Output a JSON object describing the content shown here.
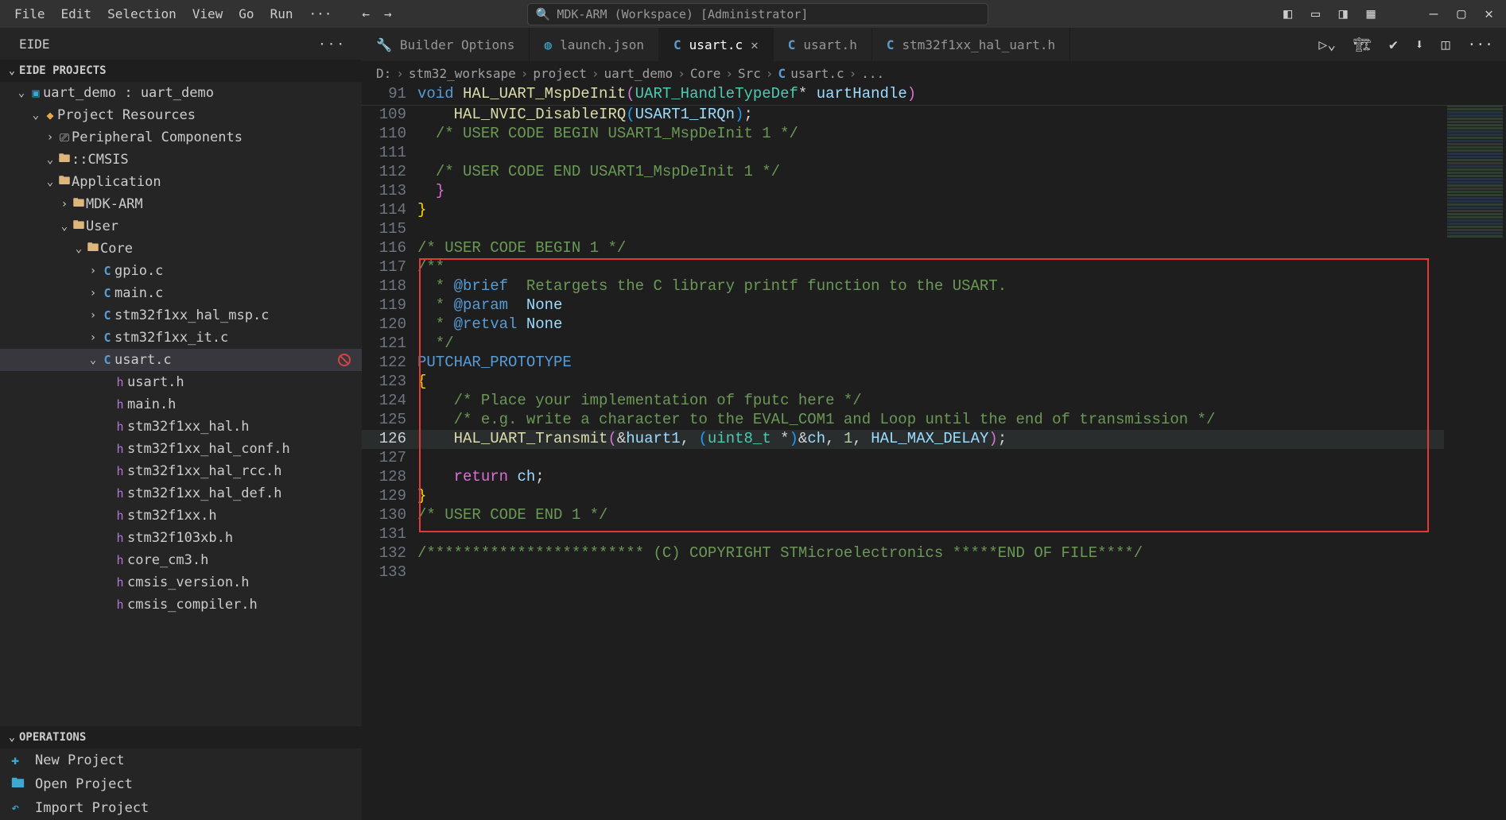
{
  "menubar": {
    "items": [
      "File",
      "Edit",
      "Selection",
      "View",
      "Go",
      "Run"
    ],
    "more": "···"
  },
  "searchbar": {
    "text": "MDK-ARM (Workspace) [Administrator]"
  },
  "sidebar": {
    "title": "EIDE",
    "section": "EIDE PROJECTS",
    "tree": {
      "project": "uart_demo : uart_demo",
      "resources": "Project Resources",
      "peripheral": "Peripheral Components",
      "cmsis": "::CMSIS",
      "application": "Application",
      "mdkarm": "MDK-ARM",
      "user": "User",
      "core": "Core",
      "files": [
        "gpio.c",
        "main.c",
        "stm32f1xx_hal_msp.c",
        "stm32f1xx_it.c",
        "usart.c"
      ],
      "headers": [
        "usart.h",
        "main.h",
        "stm32f1xx_hal.h",
        "stm32f1xx_hal_conf.h",
        "stm32f1xx_hal_rcc.h",
        "stm32f1xx_hal_def.h",
        "stm32f1xx.h",
        "stm32f103xb.h",
        "core_cm3.h",
        "cmsis_version.h",
        "cmsis_compiler.h"
      ]
    },
    "ops_title": "OPERATIONS",
    "ops": [
      "New Project",
      "Open Project",
      "Import Project"
    ]
  },
  "tabs": [
    {
      "label": "Builder Options",
      "icon": "wrench"
    },
    {
      "label": "launch.json",
      "icon": "green"
    },
    {
      "label": "usart.c",
      "icon": "C",
      "active": true,
      "close": true
    },
    {
      "label": "usart.h",
      "icon": "C"
    },
    {
      "label": "stm32f1xx_hal_uart.h",
      "icon": "C"
    }
  ],
  "breadcrumb": [
    "D:",
    "stm32_worksape",
    "project",
    "uart_demo",
    "Core",
    "Src",
    "usart.c",
    "..."
  ],
  "sticky": {
    "num": "91",
    "kw": "void ",
    "fn": "HAL_UART_MspDeInit",
    "open": "(",
    "type": "UART_HandleTypeDef",
    "star": "* ",
    "arg": "uartHandle",
    "close": ")"
  },
  "code": {
    "l109": {
      "fn": "HAL_NVIC_DisableIRQ",
      "open": "(",
      "arg": "USART1_IRQn",
      "close": ")",
      "sc": ";"
    },
    "l110": "/* USER CODE BEGIN USART1_MspDeInit 1 */",
    "l112": "/* USER CODE END USART1_MspDeInit 1 */",
    "l113": "}",
    "l114": "}",
    "l116": "/* USER CODE BEGIN 1 */",
    "l117": "/**",
    "l118a": "  * ",
    "l118b": "@brief",
    "l118c": "  Retargets the C library printf function to the USART.",
    "l119a": "  * ",
    "l119b": "@param",
    "l119c": "  ",
    "l119d": "None",
    "l120a": "  * ",
    "l120b": "@retval",
    "l120c": " ",
    "l120d": "None",
    "l121": "  */",
    "l122": "PUTCHAR_PROTOTYPE",
    "l123": "{",
    "l124": "/* Place your implementation of fputc here */",
    "l125": "/* e.g. write a character to the EVAL_COM1 and Loop until the end of transmission */",
    "l126fn": "HAL_UART_Transmit",
    "l126o": "(",
    "l126a1": "&",
    "l126a2": "huart1",
    "l126c1": ", ",
    "l126ct": "(",
    "l126t": "uint8_t ",
    "l126s": "*",
    "l126cte": ")",
    "l126amp": "&",
    "l126ch": "ch",
    "l126c2": ", ",
    "l126n": "1",
    "l126c3": ", ",
    "l126mx": "HAL_MAX_DELAY",
    "l126cl": ")",
    "l126sc": ";",
    "l128a": "return ",
    "l128b": "ch",
    "l128c": ";",
    "l129": "}",
    "l130": "/* USER CODE END 1 */",
    "l132": "/************************ (C) COPYRIGHT STMicroelectronics *****END OF FILE****/"
  },
  "linenums": [
    "109",
    "110",
    "111",
    "112",
    "113",
    "114",
    "115",
    "116",
    "117",
    "118",
    "119",
    "120",
    "121",
    "122",
    "123",
    "124",
    "125",
    "126",
    "127",
    "128",
    "129",
    "130",
    "131",
    "132",
    "133"
  ]
}
